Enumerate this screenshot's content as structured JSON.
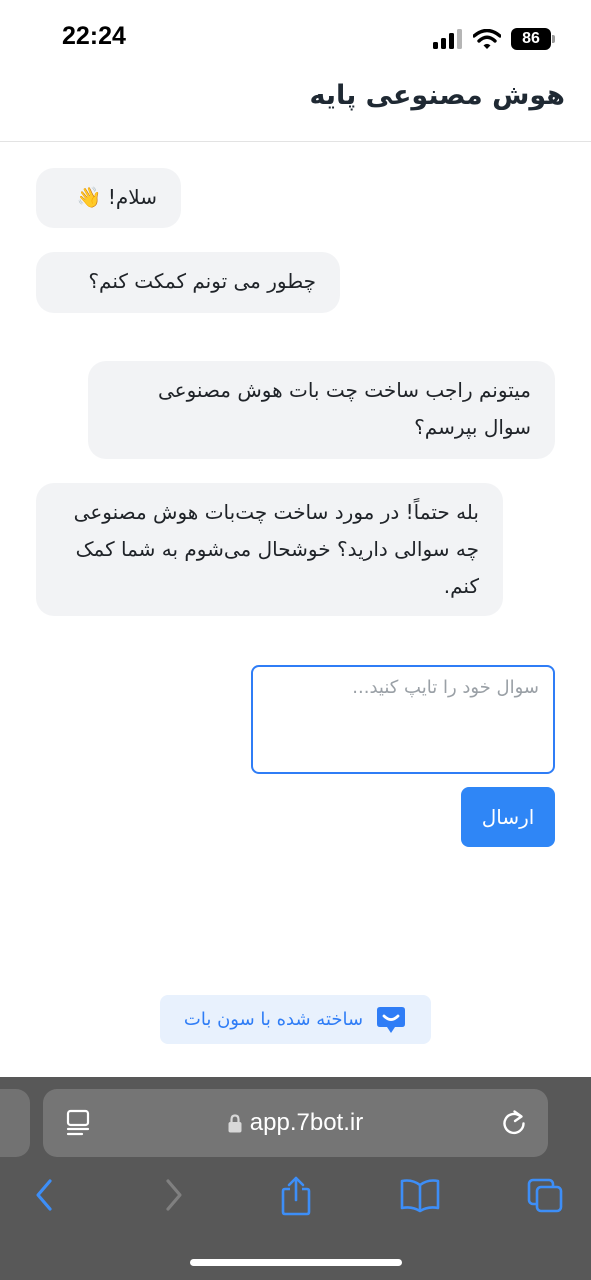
{
  "status_bar": {
    "time": "22:24",
    "battery": "86",
    "icons": [
      "signal-icon",
      "wifi-icon",
      "battery-icon"
    ]
  },
  "header": {
    "title": "هوش مصنوعی پایه"
  },
  "messages": [
    {
      "role": "bot",
      "text": "سلام! 👋"
    },
    {
      "role": "bot",
      "text": "چطور می تونم کمکت کنم؟"
    },
    {
      "role": "user",
      "text": "میتونم راجب ساخت چت بات هوش مصنوعی سوال بپرسم؟"
    },
    {
      "role": "bot",
      "text": "بله حتماً! در مورد ساخت چت‌بات هوش مصنوعی چه سوالی دارید؟ خوشحال می‌شوم به شما کمک کنم."
    }
  ],
  "input": {
    "placeholder": "سوال خود را تایپ کنید...",
    "value": ""
  },
  "send_button": {
    "label": "ارسال"
  },
  "branding": {
    "label": "ساخته شده با سون بات",
    "icon": "chat-bubble-logo-icon"
  },
  "browser": {
    "url": "app.7bot.ir",
    "icons": [
      "reader-icon",
      "lock-icon",
      "reload-icon",
      "back-icon",
      "forward-icon",
      "share-icon",
      "bookmarks-icon",
      "tabs-icon"
    ]
  },
  "colors": {
    "accent": "#2f86f6",
    "bubble_bg": "#f2f3f5",
    "badge_bg": "#e8f1fd",
    "toolbar_bg": "#585858"
  }
}
